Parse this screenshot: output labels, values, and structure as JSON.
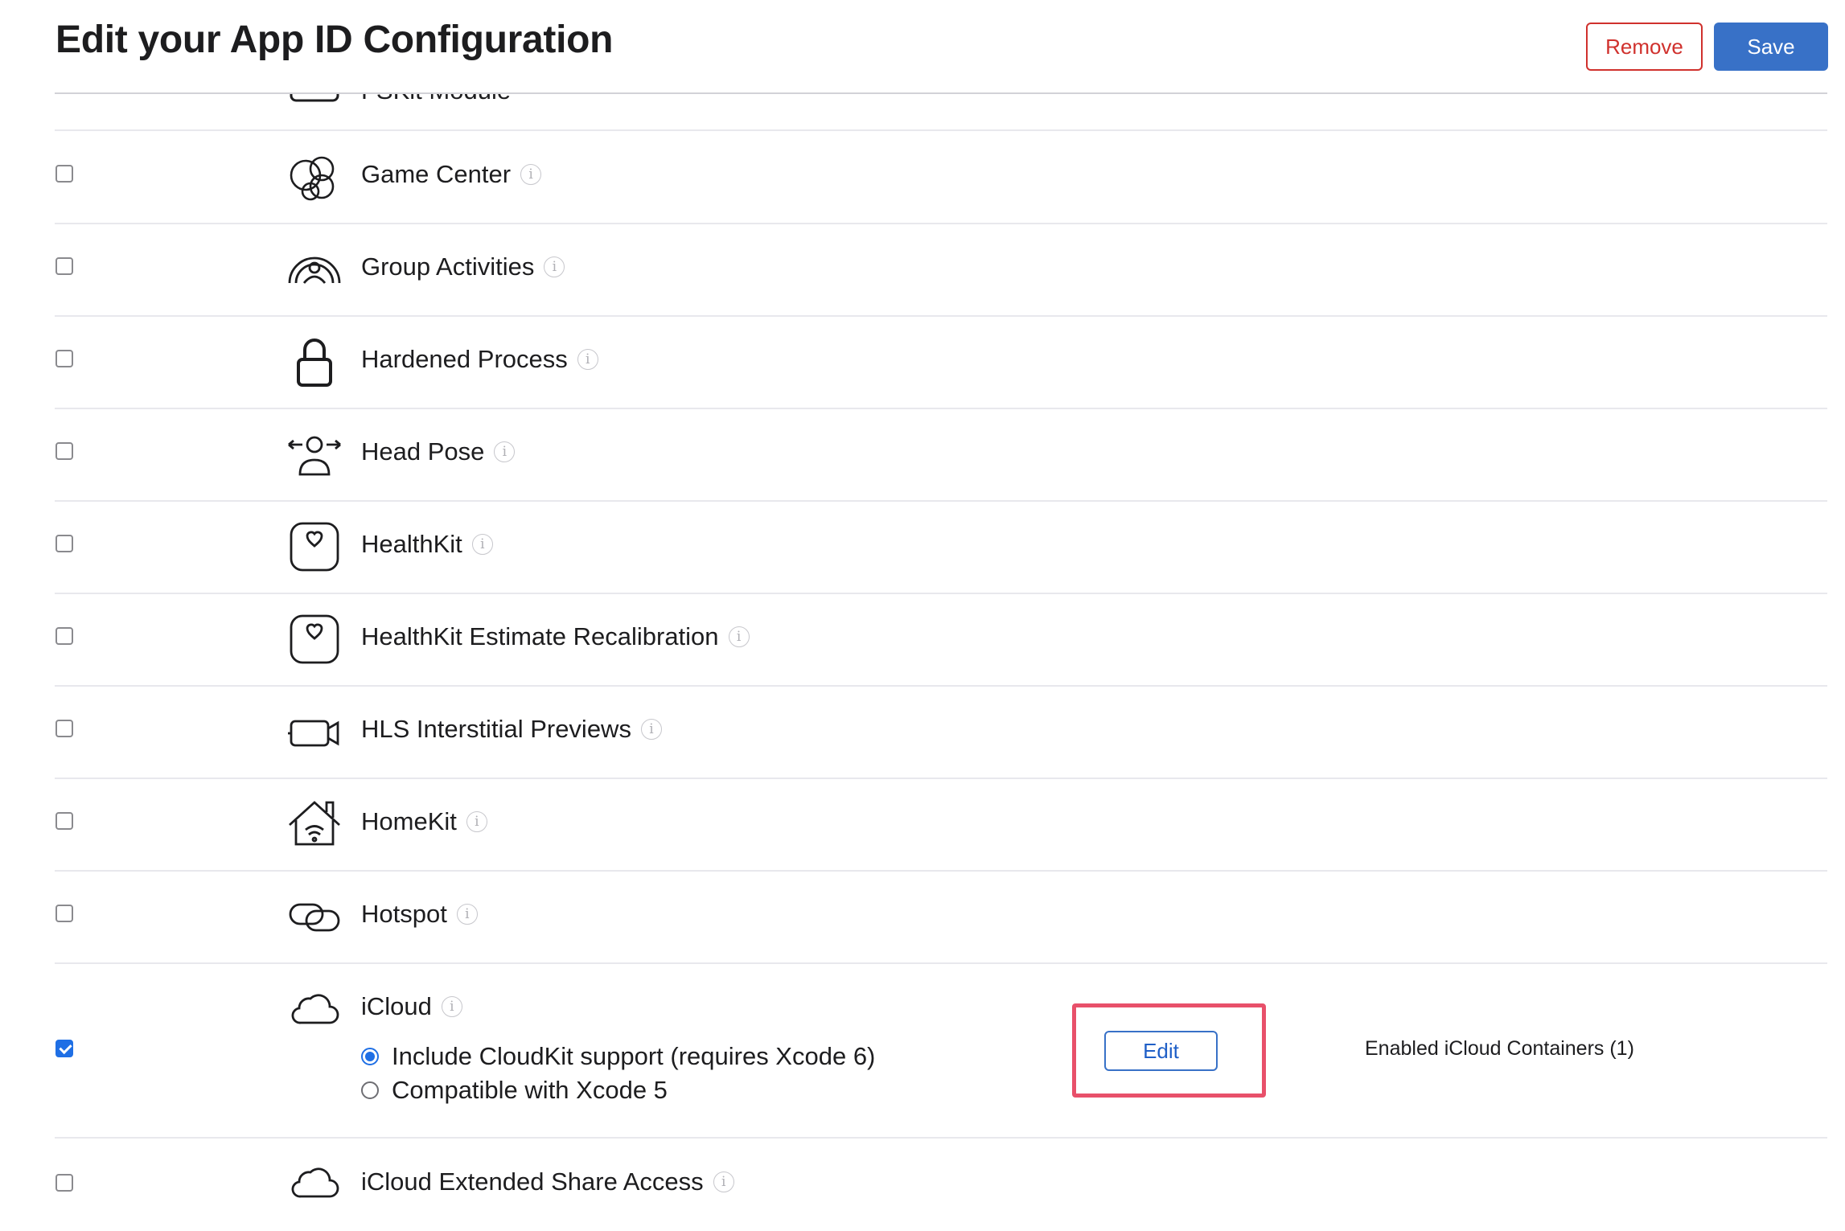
{
  "page": {
    "title": "Edit your App ID Configuration",
    "remove_label": "Remove",
    "save_label": "Save"
  },
  "partial_row": {
    "label": "FSKit Module",
    "icon": "module-icon"
  },
  "capabilities": [
    {
      "label": "Game Center",
      "icon": "game-center-icon",
      "checked": false
    },
    {
      "label": "Group Activities",
      "icon": "group-activities-icon",
      "checked": false
    },
    {
      "label": "Hardened Process",
      "icon": "lock-icon",
      "checked": false
    },
    {
      "label": "Head Pose",
      "icon": "head-pose-icon",
      "checked": false
    },
    {
      "label": "HealthKit",
      "icon": "healthkit-icon",
      "checked": false
    },
    {
      "label": "HealthKit Estimate Recalibration",
      "icon": "healthkit-icon",
      "checked": false
    },
    {
      "label": "HLS Interstitial Previews",
      "icon": "video-camera-icon",
      "checked": false
    },
    {
      "label": "HomeKit",
      "icon": "homekit-icon",
      "checked": false
    },
    {
      "label": "Hotspot",
      "icon": "hotspot-icon",
      "checked": false
    }
  ],
  "icloud": {
    "label": "iCloud",
    "icon": "cloud-icon",
    "checked": true,
    "options": [
      {
        "label": "Include CloudKit support (requires Xcode 6)",
        "selected": true
      },
      {
        "label": "Compatible with Xcode 5",
        "selected": false
      }
    ],
    "edit_label": "Edit",
    "containers_label": "Enabled iCloud Containers (1)",
    "highlight_color": "#e8506a"
  },
  "last_row": {
    "label": "iCloud Extended Share Access",
    "icon": "cloud-icon",
    "checked": false
  },
  "colors": {
    "accent": "#3871c7",
    "danger": "#d0312d",
    "checkbox_checked": "#1f6fe5"
  }
}
